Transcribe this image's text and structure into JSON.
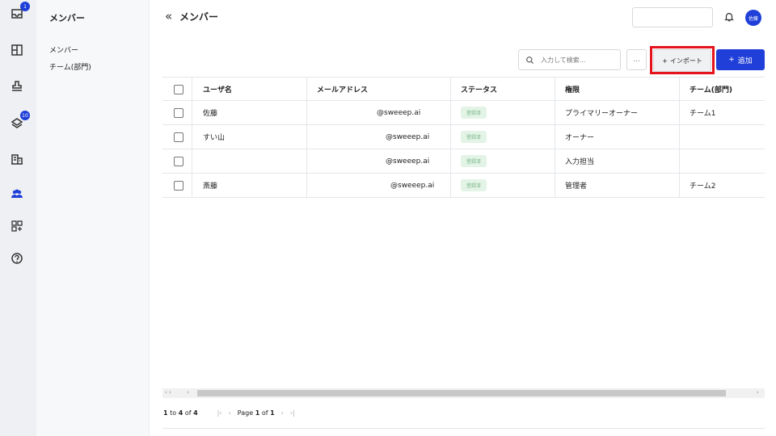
{
  "rail": {
    "inbox_badge": "1",
    "tasks_badge": "10"
  },
  "subnav": {
    "title": "メンバー",
    "items": [
      "メンバー",
      "チーム(部門)"
    ]
  },
  "header": {
    "title": "メンバー",
    "avatar_text": "佐藤"
  },
  "toolbar": {
    "search_placeholder": "入力して検索...",
    "more_label": "...",
    "import_label": "インポート",
    "add_label": "追加"
  },
  "table": {
    "columns": [
      "ユーザ名",
      "メールアドレス",
      "ステータス",
      "権限",
      "チーム(部門)"
    ],
    "rows": [
      {
        "name": "佐藤",
        "email": "@sweeep.ai",
        "status": "登録済",
        "role": "プライマリーオーナー",
        "team": "チーム1"
      },
      {
        "name": "すい山",
        "email": "@sweeep.ai",
        "status": "登録済",
        "role": "オーナー",
        "team": ""
      },
      {
        "name": "",
        "email": "@sweeep.ai",
        "status": "登録済",
        "role": "入力担当",
        "team": ""
      },
      {
        "name": "斎藤",
        "email": "@sweeep.ai",
        "status": "登録済",
        "role": "管理者",
        "team": "チーム2"
      }
    ]
  },
  "pager": {
    "range_from": "1",
    "range_to": "4",
    "total": "4",
    "page": "1",
    "page_count": "1",
    "to_word": "to",
    "of_word": "of",
    "page_word": "Page"
  },
  "colors": {
    "accent": "#1f3fd8",
    "highlight": "#e5131b",
    "status_bg": "#e3f4e6"
  }
}
